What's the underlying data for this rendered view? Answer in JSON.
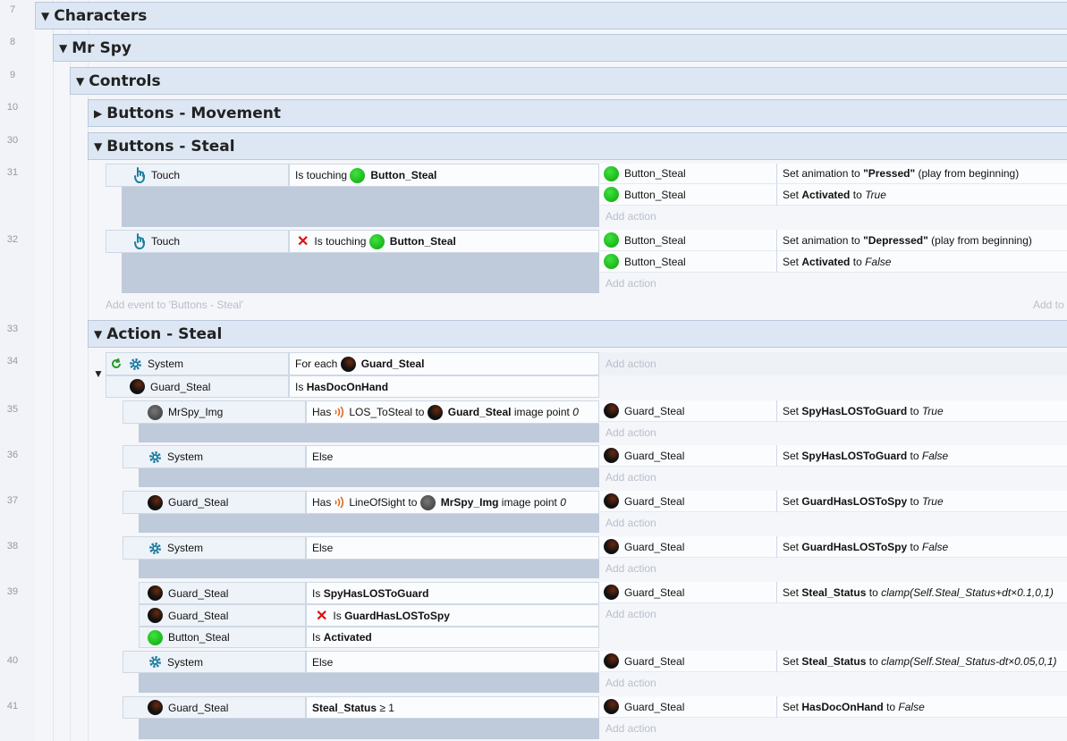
{
  "line_numbers": [
    "7",
    "8",
    "9",
    "10",
    "30",
    "31",
    "32",
    "33",
    "34",
    "35",
    "36",
    "37",
    "38",
    "39",
    "40",
    "41"
  ],
  "groups": {
    "characters": "Characters",
    "mr_spy": "Mr Spy",
    "controls": "Controls",
    "buttons_movement": "Buttons - Movement",
    "buttons_steal": "Buttons - Steal",
    "action_steal": "Action - Steal"
  },
  "common": {
    "touch": "Touch",
    "system": "System",
    "guard": "Guard_Steal",
    "button": "Button_Steal",
    "spy": "MrSpy_Img",
    "else": "Else",
    "add_action": "Add action",
    "is_touching": "Is touching",
    "set_anim": "Set animation to",
    "play": "(play from beginning)",
    "set": "Set",
    "to": "to",
    "true": "True",
    "false": "False",
    "has": "Has",
    "image_point": "image point",
    "zero": "0",
    "is": "Is"
  },
  "e31": {
    "pressed": "\"Pressed\"",
    "activated": "Activated"
  },
  "e32": {
    "depressed": "\"Depressed\""
  },
  "add_event": "Add event to 'Buttons - Steal'",
  "add_to": "Add to",
  "e34": {
    "for_each": "For each",
    "cond2": "HasDocOnHand"
  },
  "e35": {
    "los": "LOS_ToSteal",
    "to": "to",
    "var": "SpyHasLOSToGuard"
  },
  "e37": {
    "los": "LineOfSight",
    "to": "to",
    "var": "GuardHasLOSToSpy"
  },
  "e39": {
    "c1": "SpyHasLOSToGuard",
    "c2": "GuardHasLOSToSpy",
    "c3": "Activated",
    "var": "Steal_Status",
    "expr": "clamp(Self.Steal_Status+dt×0.1,0,1)"
  },
  "e40": {
    "expr": "clamp(Self.Steal_Status-dt×0.05,0,1)"
  },
  "e41": {
    "cond": "Steal_Status",
    "op": "≥ 1",
    "var": "HasDocOnHand"
  },
  "colors": {
    "group_bg": "#dde7f3",
    "event_bg": "#bfcadb",
    "green": "#12b312",
    "red": "#e01010"
  }
}
